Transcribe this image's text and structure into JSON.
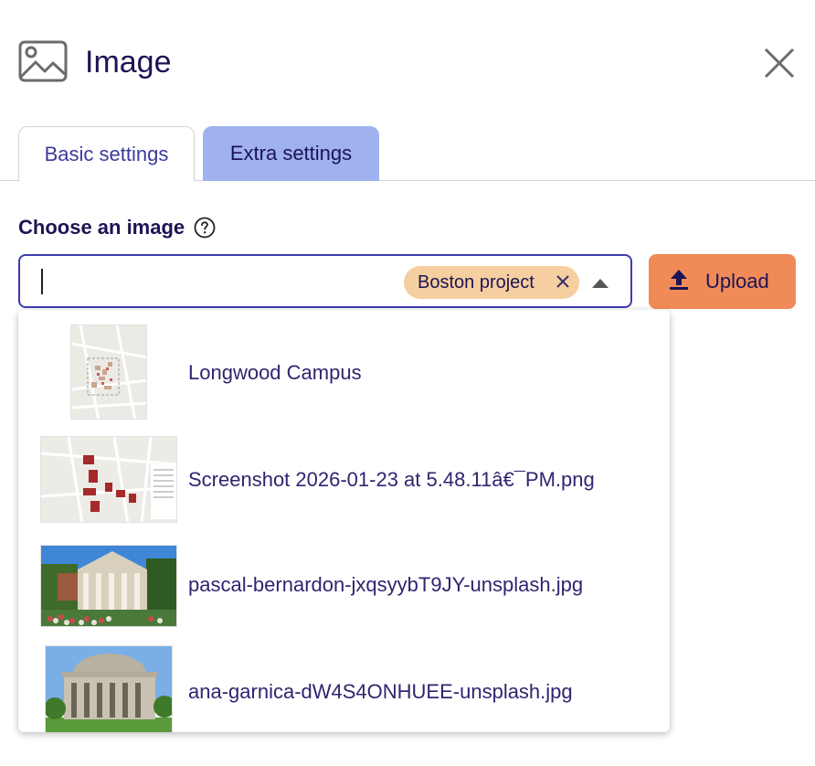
{
  "dialog": {
    "title": "Image",
    "title_icon": "image-icon",
    "close_icon": "close-icon"
  },
  "tabs": [
    {
      "label": "Basic settings",
      "active": true
    },
    {
      "label": "Extra settings",
      "active": false
    }
  ],
  "field": {
    "label": "Choose an image",
    "help_icon": "help-icon",
    "input_value": "",
    "chip": {
      "label": "Boston project",
      "remove_icon": "close-icon"
    },
    "toggle_icon": "caret-up-icon"
  },
  "upload": {
    "label": "Upload",
    "icon": "upload-icon"
  },
  "options": [
    {
      "label": "Longwood Campus",
      "thumb": "map-thumbnail"
    },
    {
      "label": "Screenshot 2026-01-23 at 5.48.11â€¯PM.png",
      "thumb": "map-screenshot-thumbnail"
    },
    {
      "label": "pascal-bernardon-jxqsyybT9JY-unsplash.jpg",
      "thumb": "building-photo-thumbnail"
    },
    {
      "label": "ana-garnica-dW4S4ONHUEE-unsplash.jpg",
      "thumb": "dome-building-photo-thumbnail"
    }
  ],
  "colors": {
    "primary_text": "#1c1454",
    "tab_active_text": "#3c3a9c",
    "tab_inactive_bg": "#9fb2ef",
    "input_border": "#3b3bb0",
    "chip_bg": "#f6cfa0",
    "upload_bg": "#f08b58"
  }
}
